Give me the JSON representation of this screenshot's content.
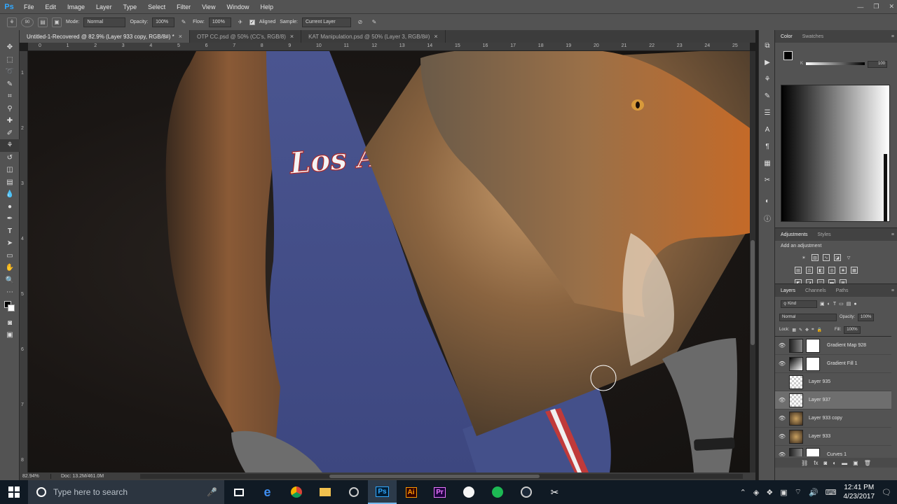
{
  "menubar": {
    "logo": "Ps",
    "items": [
      "File",
      "Edit",
      "Image",
      "Layer",
      "Type",
      "Select",
      "Filter",
      "View",
      "Window",
      "Help"
    ]
  },
  "options": {
    "mode_label": "Mode:",
    "mode_value": "Normal",
    "opacity_label": "Opacity:",
    "opacity_value": "100%",
    "flow_label": "Flow:",
    "flow_value": "100%",
    "aligned_label": "Aligned",
    "sample_label": "Sample:",
    "sample_value": "Current Layer",
    "brush_size": "90"
  },
  "tabs": [
    {
      "label": "Untitled-1-Recovered @ 82.9% (Layer 933 copy, RGB/8#) *",
      "active": true
    },
    {
      "label": "OTP CC.psd @ 50% (CC's, RGB/8)",
      "active": false
    },
    {
      "label": "KAT Manipulation.psd @ 50% (Layer 3, RGB/8#)",
      "active": false
    }
  ],
  "ruler_top": [
    "0",
    "1",
    "2",
    "3",
    "4",
    "5",
    "6",
    "7",
    "8",
    "9",
    "10",
    "11",
    "12",
    "13",
    "14",
    "15",
    "16",
    "17",
    "18",
    "19",
    "20",
    "21",
    "22",
    "23",
    "24",
    "25"
  ],
  "ruler_left": [
    "1",
    "2",
    "3",
    "4",
    "5",
    "6",
    "7",
    "8"
  ],
  "canvas": {
    "jersey_text": "Los A"
  },
  "statusbar": {
    "zoom": "82.94%",
    "doc": "Doc: 13.2M/461.0M"
  },
  "color_panel": {
    "tabs": [
      "Color",
      "Swatches"
    ],
    "k_label": "K",
    "k_value": "100"
  },
  "adjust_panel": {
    "tabs": [
      "Adjustments",
      "Styles"
    ],
    "title": "Add an adjustment"
  },
  "layers_panel": {
    "tabs": [
      "Layers",
      "Channels",
      "Paths"
    ],
    "kind_label": "Kind",
    "blend_mode": "Normal",
    "opacity_label": "Opacity:",
    "opacity_value": "100%",
    "lock_label": "Lock:",
    "fill_label": "Fill:",
    "fill_value": "100%",
    "layers": [
      {
        "name": "Gradient Map 928",
        "visible": true,
        "selected": false,
        "kind": "adjustment"
      },
      {
        "name": "Gradient Fill 1",
        "visible": true,
        "selected": false,
        "kind": "fill"
      },
      {
        "name": "Layer 935",
        "visible": false,
        "selected": false,
        "kind": "pixel"
      },
      {
        "name": "Layer 937",
        "visible": true,
        "selected": true,
        "kind": "pixel"
      },
      {
        "name": "Layer 933 copy",
        "visible": true,
        "selected": false,
        "kind": "photo"
      },
      {
        "name": "Layer 933",
        "visible": true,
        "selected": false,
        "kind": "photo"
      },
      {
        "name": "Curves 1",
        "visible": true,
        "selected": false,
        "kind": "adjustment"
      }
    ]
  },
  "taskbar": {
    "search_placeholder": "Type here to search",
    "time": "12:41 PM",
    "date": "4/23/2017"
  },
  "colors": {
    "ps_blue": "#31a8ff",
    "panel_bg": "#535353",
    "selected_layer": "#6e6e6e",
    "taskbar_bg": "#101a24"
  }
}
